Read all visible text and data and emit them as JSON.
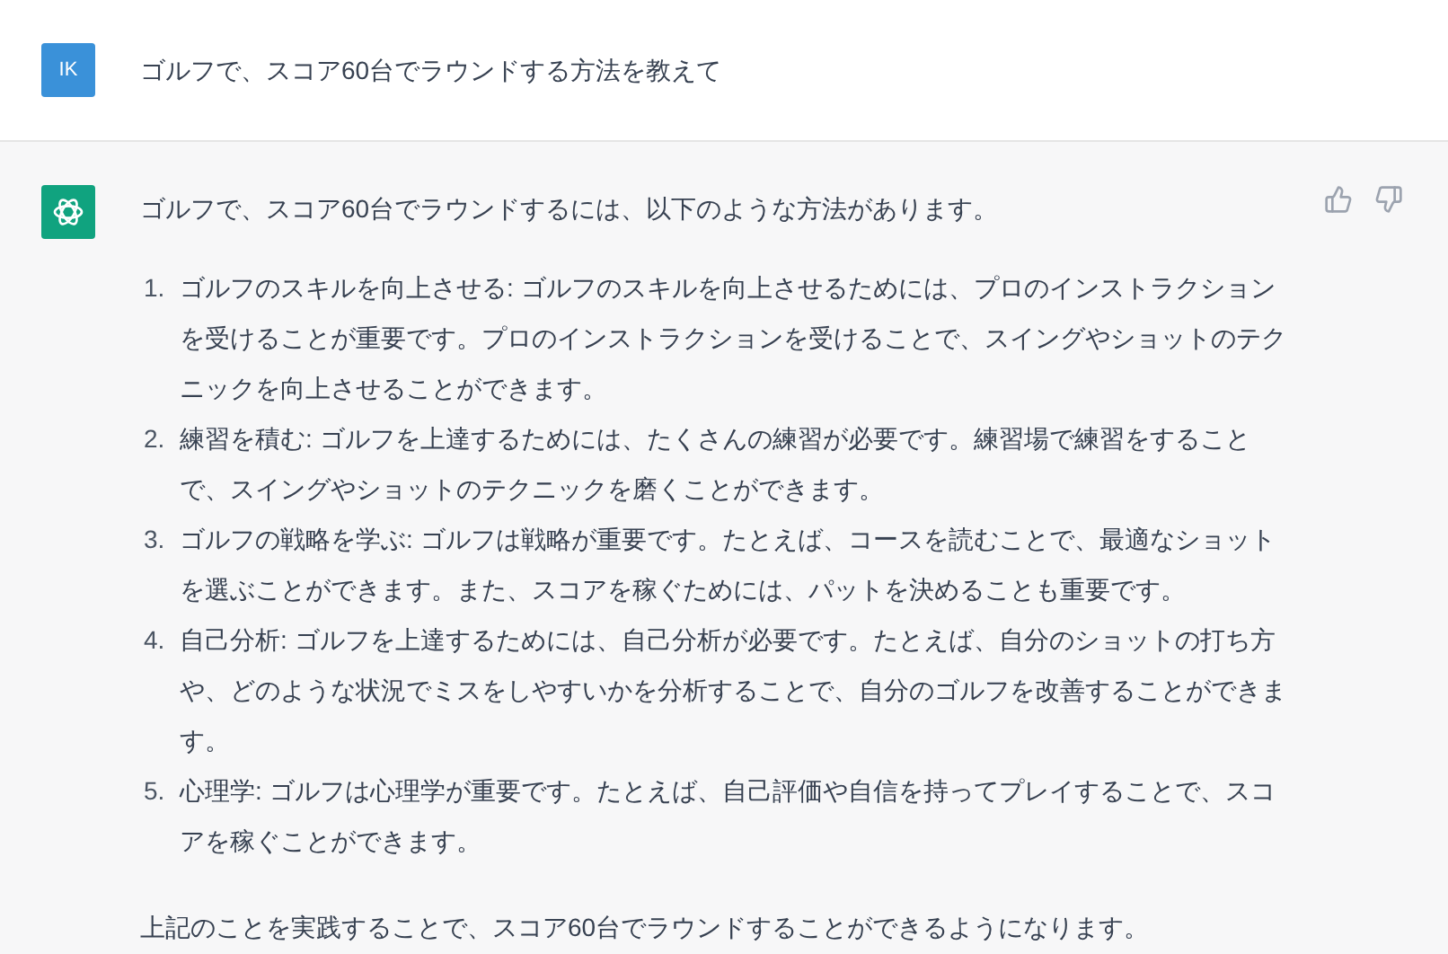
{
  "user_message": {
    "avatar": "IK",
    "text": "ゴルフで、スコア60台でラウンドする方法を教えて"
  },
  "assistant_message": {
    "intro": "ゴルフで、スコア60台でラウンドするには、以下のような方法があります。",
    "list": [
      {
        "number": "1.",
        "text": "ゴルフのスキルを向上させる: ゴルフのスキルを向上させるためには、プロのインストラクションを受けることが重要です。プロのインストラクションを受けることで、スイングやショットのテクニックを向上させることができます。"
      },
      {
        "number": "2.",
        "text": "練習を積む: ゴルフを上達するためには、たくさんの練習が必要です。練習場で練習をすることで、スイングやショットのテクニックを磨くことができます。"
      },
      {
        "number": "3.",
        "text": "ゴルフの戦略を学ぶ: ゴルフは戦略が重要です。たとえば、コースを読むことで、最適なショットを選ぶことができます。また、スコアを稼ぐためには、パットを決めることも重要です。"
      },
      {
        "number": "4.",
        "text": "自己分析: ゴルフを上達するためには、自己分析が必要です。たとえば、自分のショットの打ち方や、どのような状況でミスをしやすいかを分析することで、自分のゴルフを改善することができます。"
      },
      {
        "number": "5.",
        "text": "心理学: ゴルフは心理学が重要です。たとえば、自己評価や自信を持ってプレイすることで、スコアを稼ぐことができます。"
      }
    ],
    "conclusion": "上記のことを実践することで、スコア60台でラウンドすることができるようになります。"
  }
}
